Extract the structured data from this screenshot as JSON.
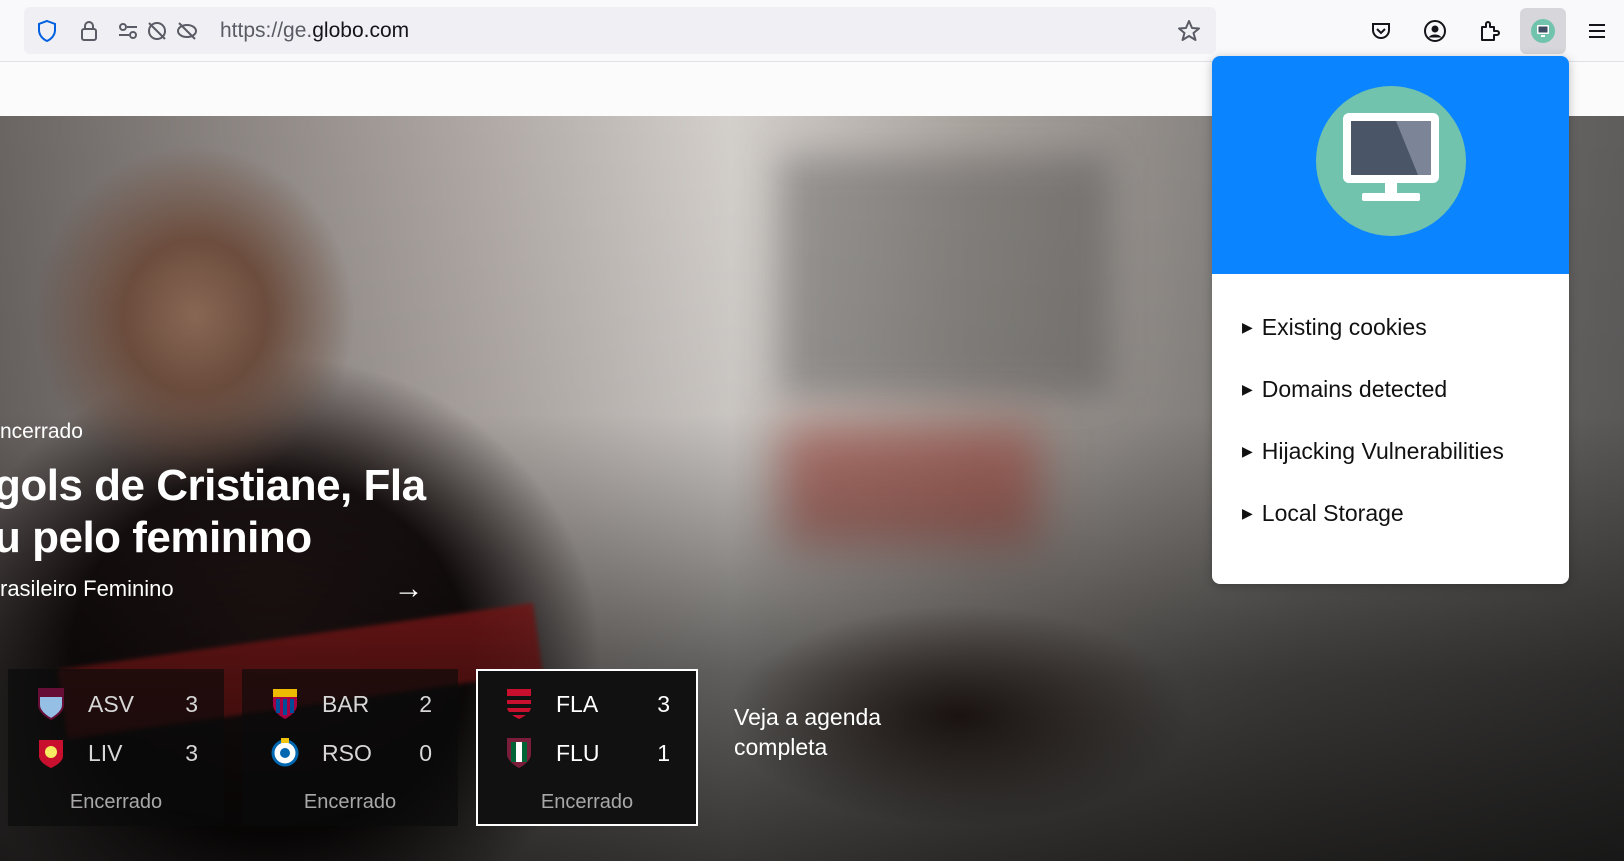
{
  "browser": {
    "url_prefix": "https://ge.",
    "url_domain": "globo.com"
  },
  "hero": {
    "status": "ncerrado",
    "title_line1": "gols de Cristiane, Fla",
    "title_line2": "u pelo feminino",
    "subtitle": "rasileiro Feminino",
    "arrow": "→"
  },
  "scores": [
    {
      "home": "ASV",
      "home_score": "3",
      "away": "LIV",
      "away_score": "3",
      "status": "Encerrado"
    },
    {
      "home": "BAR",
      "home_score": "2",
      "away": "RSO",
      "away_score": "0",
      "status": "Encerrado"
    },
    {
      "home": "FLA",
      "home_score": "3",
      "away": "FLU",
      "away_score": "1",
      "status": "Encerrado"
    }
  ],
  "agenda_link": "Veja a agenda completa",
  "popup": {
    "items": [
      {
        "label": "Existing cookies"
      },
      {
        "label": "Domains detected"
      },
      {
        "label": "Hijacking Vulnerabilities"
      },
      {
        "label": "Local Storage"
      }
    ],
    "marker": "▶"
  },
  "colors": {
    "popup_header": "#0a84ff",
    "monitor_circle": "#72c3ad"
  }
}
